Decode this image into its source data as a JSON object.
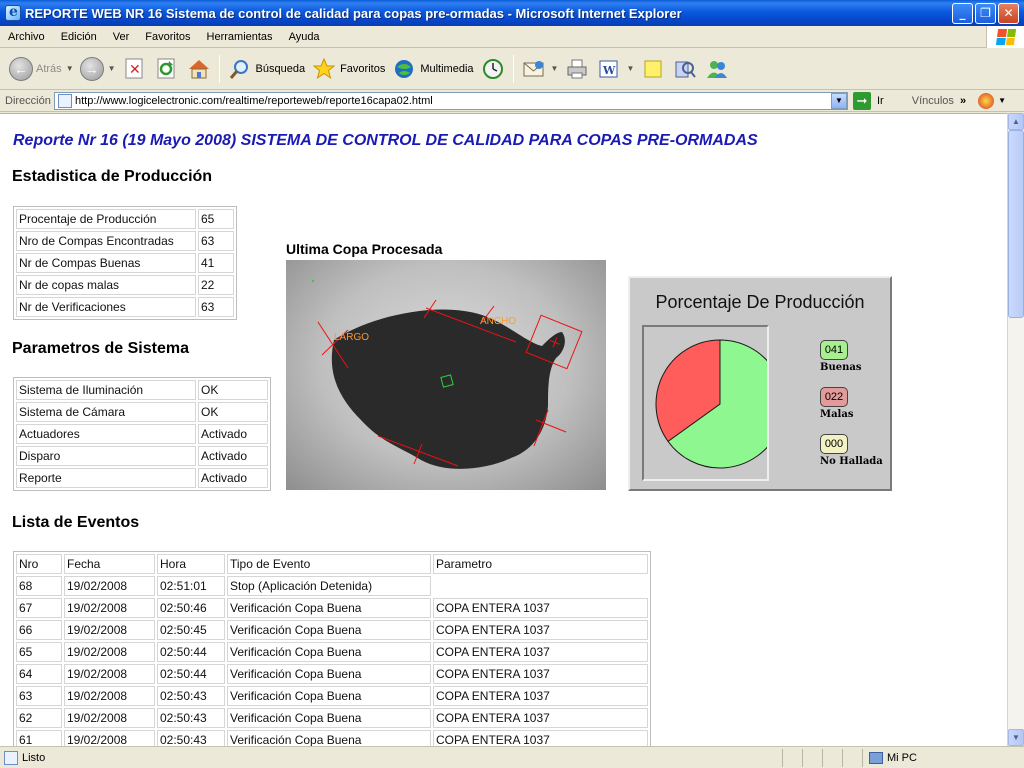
{
  "window": {
    "title": "REPORTE WEB NR 16 Sistema de control de calidad para copas pre-ormadas - Microsoft Internet Explorer",
    "minimize": "_",
    "maximize": "❐",
    "close": "✕"
  },
  "menu": [
    "Archivo",
    "Edición",
    "Ver",
    "Favoritos",
    "Herramientas",
    "Ayuda"
  ],
  "toolbar": {
    "back": "Atrás",
    "search": "Búsqueda",
    "favorites": "Favoritos",
    "multimedia": "Multimedia"
  },
  "address": {
    "label": "Dirección",
    "url": "http://www.logicelectronic.com/realtime/reporteweb/reporte16capa02.html",
    "go": "Ir",
    "links": "Vínculos"
  },
  "report": {
    "title": "Reporte Nr 16 (19 Mayo 2008) SISTEMA DE CONTROL DE CALIDAD PARA COPAS PRE-ORMADAS"
  },
  "production": {
    "heading": "Estadistica de Producción",
    "rows": [
      {
        "label": "Procentaje de Producción",
        "value": "65"
      },
      {
        "label": "Nro de Compas Encontradas",
        "value": "63"
      },
      {
        "label": "Nr de Compas Buenas",
        "value": "41"
      },
      {
        "label": "Nr de copas malas",
        "value": "22"
      },
      {
        "label": "Nr de Verificaciones",
        "value": "63"
      }
    ]
  },
  "system": {
    "heading": "Parametros de Sistema",
    "rows": [
      {
        "label": "Sistema de Iluminación",
        "value": "OK"
      },
      {
        "label": "Sistema de Cámara",
        "value": "OK"
      },
      {
        "label": "Actuadores",
        "value": "Activado"
      },
      {
        "label": "Disparo",
        "value": "Activado"
      },
      {
        "label": "Reporte",
        "value": "Activado"
      }
    ]
  },
  "image": {
    "title": "Ultima Copa Procesada",
    "label_largo": "LARGO",
    "label_ancho": "ANCHO"
  },
  "chart": {
    "title": "Porcentaje De Producción",
    "legend": [
      {
        "code": "041",
        "label": "Buenas",
        "color": "#a7f08f"
      },
      {
        "code": "022",
        "label": "Malas",
        "color": "#e39a9a"
      },
      {
        "code": "000",
        "label": "No Hallada",
        "color": "#f2f2c4"
      }
    ],
    "slices": [
      {
        "name": "Buenas",
        "value": 41,
        "color": "#8ff78f"
      },
      {
        "name": "Malas",
        "value": 22,
        "color": "#ff5c5c"
      }
    ]
  },
  "events": {
    "heading": "Lista de Eventos",
    "columns": [
      "Nro",
      "Fecha",
      "Hora",
      "Tipo de Evento",
      "Parametro"
    ],
    "rows": [
      [
        "68",
        "19/02/2008",
        "02:51:01",
        "Stop (Aplicación Detenida)",
        ""
      ],
      [
        "67",
        "19/02/2008",
        "02:50:46",
        "Verificación Copa Buena",
        "COPA ENTERA 1037"
      ],
      [
        "66",
        "19/02/2008",
        "02:50:45",
        "Verificación Copa Buena",
        "COPA ENTERA 1037"
      ],
      [
        "65",
        "19/02/2008",
        "02:50:44",
        "Verificación Copa Buena",
        "COPA ENTERA 1037"
      ],
      [
        "64",
        "19/02/2008",
        "02:50:44",
        "Verificación Copa Buena",
        "COPA ENTERA 1037"
      ],
      [
        "63",
        "19/02/2008",
        "02:50:43",
        "Verificación Copa Buena",
        "COPA ENTERA 1037"
      ],
      [
        "62",
        "19/02/2008",
        "02:50:43",
        "Verificación Copa Buena",
        "COPA ENTERA 1037"
      ],
      [
        "61",
        "19/02/2008",
        "02:50:43",
        "Verificación Copa Buena",
        "COPA ENTERA 1037"
      ]
    ]
  },
  "status": {
    "text": "Listo",
    "zone": "Mi PC"
  }
}
